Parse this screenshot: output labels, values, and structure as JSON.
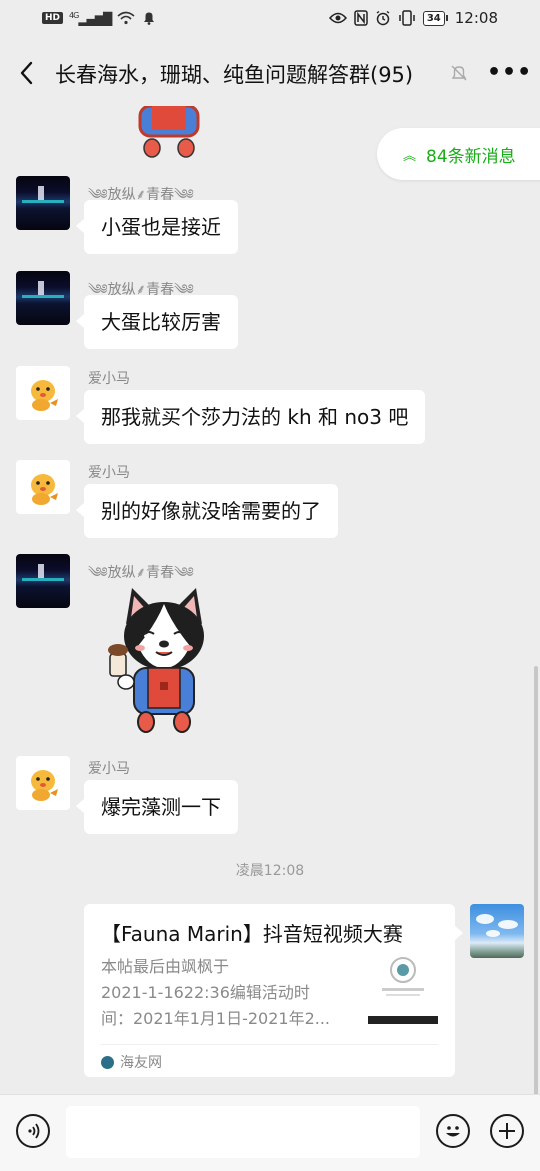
{
  "status_bar": {
    "hd_label": "HD",
    "network": "4G",
    "battery": "34",
    "time": "12:08"
  },
  "header": {
    "title": "长春海水，珊瑚、纯鱼问题解答群(95)"
  },
  "unread_banner": {
    "label": "84条新消息"
  },
  "messages": [
    {
      "sender": "༄༅放纵⸙青春༄༅",
      "text": "小蛋也是接近"
    },
    {
      "sender": "༄༅放纵⸙青春༄༅",
      "text": "大蛋比较厉害"
    },
    {
      "sender": "爱小马",
      "text": "那我就买个莎力法的 kh 和 no3 吧"
    },
    {
      "sender": "爱小马",
      "text": "别的好像就没啥需要的了"
    },
    {
      "sender": "༄༅放纵⸙青春༄༅",
      "sticker": "dog-sticker"
    },
    {
      "sender": "爱小马",
      "text": "爆完藻测一下"
    }
  ],
  "timestamp": "凌晨12:08",
  "link_card": {
    "title": "【Fauna Marin】抖音短视频大赛",
    "desc_lines": [
      "本帖最后由飒枫于",
      "2021-1-1622:36编辑活动时",
      "间：2021年1月1日-2021年2..."
    ],
    "source": "海友网"
  },
  "colors": {
    "accent_green": "#1aad19",
    "chat_background": "#ededed"
  },
  "icons": {
    "voice": "voice-icon",
    "emoji": "emoji-icon",
    "plus": "plus-icon"
  }
}
